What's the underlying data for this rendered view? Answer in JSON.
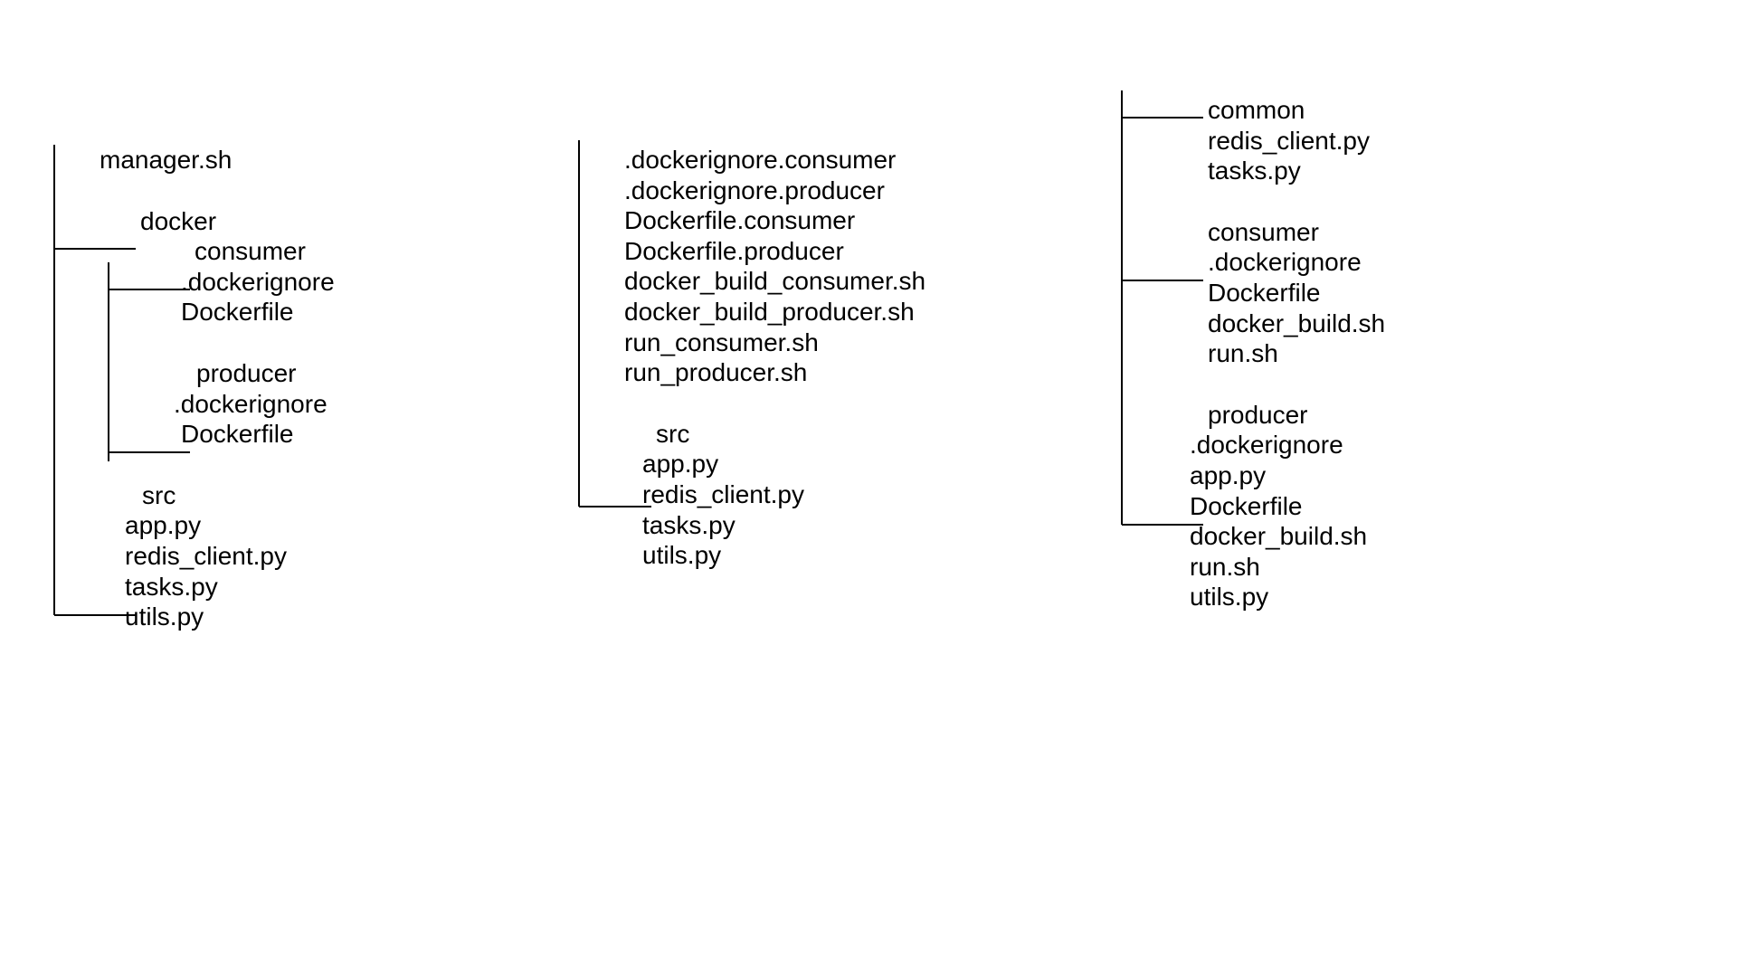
{
  "tree1": {
    "f0": "manager.sh",
    "d1": "docker",
    "d1c1": "consumer",
    "d1c1f1": ".dockerignore",
    "d1c1f2": "Dockerfile",
    "d1c2": "producer",
    "d1c2f1": ".dockerignore",
    "d1c2f2": "Dockerfile",
    "d2": "src",
    "d2f1": "app.py",
    "d2f2": "redis_client.py",
    "d2f3": "tasks.py",
    "d2f4": "utils.py"
  },
  "tree2": {
    "f1": ".dockerignore.consumer",
    "f2": ".dockerignore.producer",
    "f3": "Dockerfile.consumer",
    "f4": "Dockerfile.producer",
    "f5": "docker_build_consumer.sh",
    "f6": "docker_build_producer.sh",
    "f7": "run_consumer.sh",
    "f8": "run_producer.sh",
    "d1": "src",
    "d1f1": "app.py",
    "d1f2": "redis_client.py",
    "d1f3": "tasks.py",
    "d1f4": "utils.py"
  },
  "tree3": {
    "d1": "common",
    "d1f1": "redis_client.py",
    "d1f2": "tasks.py",
    "d2": "consumer",
    "d2f1": ".dockerignore",
    "d2f2": "Dockerfile",
    "d2f3": "docker_build.sh",
    "d2f4": "run.sh",
    "d3": "producer",
    "d3f1": ".dockerignore",
    "d3f2": "app.py",
    "d3f3": "Dockerfile",
    "d3f4": "docker_build.sh",
    "d3f5": "run.sh",
    "d3f6": "utils.py"
  }
}
